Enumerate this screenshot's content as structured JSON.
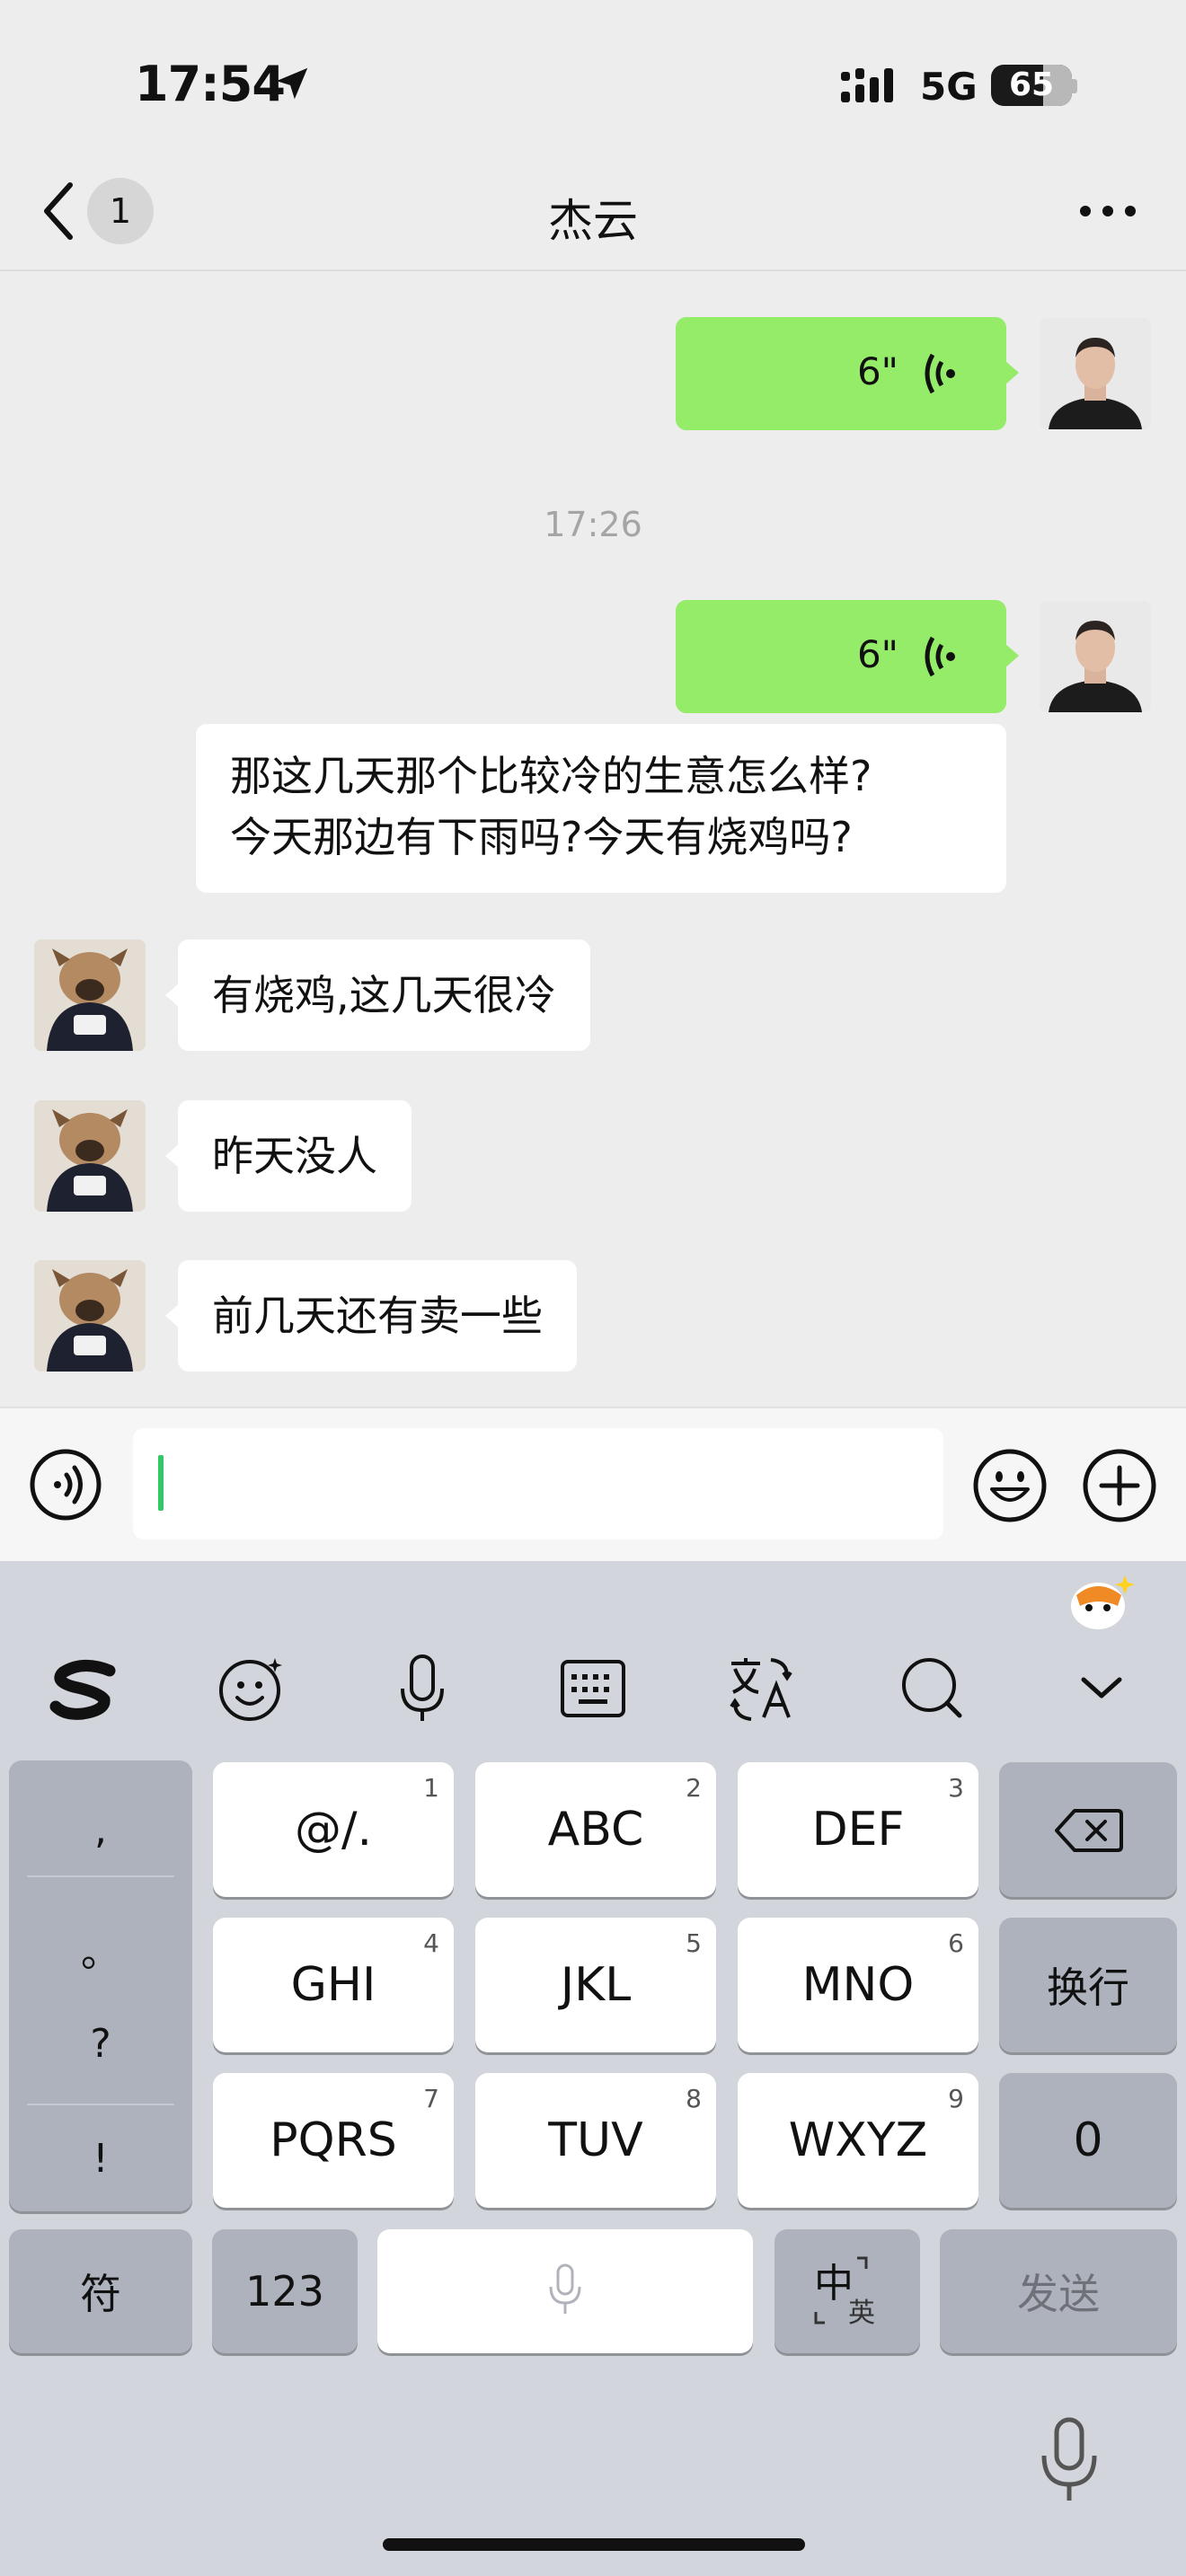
{
  "status_bar": {
    "time": "17:54",
    "network": "5G",
    "battery": "65"
  },
  "nav": {
    "unread_count": "1",
    "title": "杰云"
  },
  "chat": {
    "voice_messages": [
      {
        "duration": "6\""
      },
      {
        "duration": "6\""
      }
    ],
    "time_divider": "17:26",
    "transcription": [
      "那这几天那个比较冷的生意怎么样?",
      "今天那边有下雨吗?今天有烧鸡吗?"
    ],
    "received": [
      "有烧鸡,这几天很冷",
      "昨天没人",
      "前几天还有卖一些"
    ]
  },
  "keyboard": {
    "punctuation": [
      ",",
      "。",
      "?",
      "!"
    ],
    "keys": [
      {
        "label": "@/.",
        "num": "1"
      },
      {
        "label": "ABC",
        "num": "2"
      },
      {
        "label": "DEF",
        "num": "3"
      },
      {
        "label": "GHI",
        "num": "4"
      },
      {
        "label": "JKL",
        "num": "5"
      },
      {
        "label": "MNO",
        "num": "6"
      },
      {
        "label": "PQRS",
        "num": "7"
      },
      {
        "label": "TUV",
        "num": "8"
      },
      {
        "label": "WXYZ",
        "num": "9"
      }
    ],
    "newline_label": "换行",
    "zero_label": "0",
    "symbols_label": "符",
    "numbers_label": "123",
    "lang_main": "中",
    "lang_alt": "英",
    "send_label": "发送"
  }
}
